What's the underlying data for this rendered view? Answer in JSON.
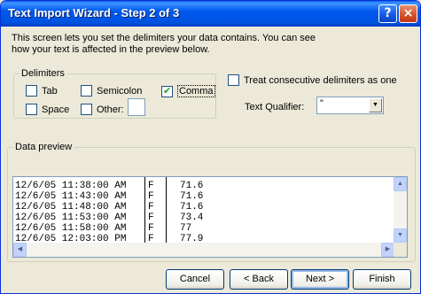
{
  "window": {
    "title": "Text Import Wizard - Step 2 of 3",
    "help_glyph": "?",
    "close_glyph": "×"
  },
  "intro": "This screen lets you set the delimiters your data contains.  You can see how your text is affected in the preview below.",
  "delimiters": {
    "label": "Delimiters",
    "tab": {
      "label": "Tab",
      "checked": false
    },
    "semicolon": {
      "label": "Semicolon",
      "checked": false
    },
    "comma": {
      "label": "Comma",
      "checked": true
    },
    "space": {
      "label": "Space",
      "checked": false
    },
    "other": {
      "label": "Other:",
      "checked": false,
      "value": ""
    }
  },
  "consecutive": {
    "label": "Treat consecutive delimiters as one",
    "checked": false
  },
  "qualifier": {
    "label": "Text Qualifier:",
    "value": "\""
  },
  "preview": {
    "label": "Data preview",
    "rows": [
      [
        "12/6/05 11:38:00 AM",
        "F",
        "71.6"
      ],
      [
        "12/6/05 11:43:00 AM",
        "F",
        "71.6"
      ],
      [
        "12/6/05 11:48:00 AM",
        "F",
        "71.6"
      ],
      [
        "12/6/05 11:53:00 AM",
        "F",
        "73.4"
      ],
      [
        "12/6/05 11:58:00 AM",
        "F",
        "77"
      ],
      [
        "12/6/05 12:03:00 PM",
        "F",
        "77.9"
      ]
    ]
  },
  "buttons": {
    "cancel": "Cancel",
    "back": "< Back",
    "next": "Next >",
    "finish": "Finish"
  },
  "icons": {
    "checkmark": "checkmark-icon",
    "dropdown": "chevron-down-icon",
    "scroll_up": "arrow-up-icon",
    "scroll_down": "arrow-down-icon",
    "scroll_left": "arrow-left-icon",
    "scroll_right": "arrow-right-icon"
  },
  "colors": {
    "title_bar": "#0058ee",
    "dialog_bg": "#ece9d8",
    "checkmark": "#21a121"
  }
}
